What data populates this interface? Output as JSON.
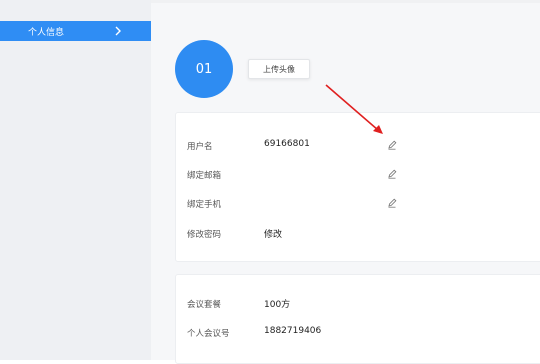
{
  "sidebar": {
    "items": [
      {
        "label": "个人信息",
        "icon": "chevron-right-icon",
        "active": true
      }
    ],
    "active_color": "#2f8df4"
  },
  "profile": {
    "avatar_text": "01",
    "upload_label": "上传头像",
    "avatar_color": "#2e8cf2"
  },
  "account": {
    "rows": [
      {
        "label": "用户名",
        "value": "69166801",
        "action_icon": "pencil-icon"
      },
      {
        "label": "绑定邮箱",
        "value": "",
        "action_icon": "pencil-icon"
      },
      {
        "label": "绑定手机",
        "value": "",
        "action_icon": "pencil-icon"
      },
      {
        "label": "修改密码",
        "value": "修改"
      }
    ]
  },
  "meeting": {
    "rows": [
      {
        "label": "会议套餐",
        "value": "100方"
      },
      {
        "label": "个人会议号",
        "value": "1882719406"
      }
    ]
  },
  "annotation": {
    "arrow_color": "#e02020"
  }
}
